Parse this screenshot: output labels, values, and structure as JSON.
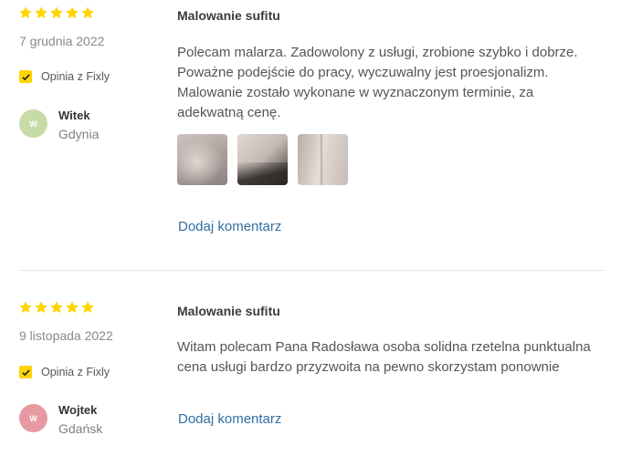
{
  "colors": {
    "star": "#ffd500",
    "badge_check": "#ffd500",
    "link": "#2f6fa3",
    "avatar_1": "#c7dba6",
    "avatar_2": "#e79aa2"
  },
  "reviews": [
    {
      "rating": 5,
      "date": "7 grudnia 2022",
      "badge": "Opinia z Fixly",
      "author": {
        "initial": "W",
        "name": "Witek",
        "city": "Gdynia"
      },
      "title": "Malowanie sufitu",
      "text": "Polecam malarza. Zadowolony z usługi, zrobione szybko i dobrze. Poważne podejście do pracy, wyczuwalny jest proesjonalizm. Malowanie zostało wykonane w wyznaczonym terminie, za adekwatną cenę.",
      "photos": 3,
      "comment_link": "Dodaj komentarz"
    },
    {
      "rating": 5,
      "date": "9 listopada 2022",
      "badge": "Opinia z Fixly",
      "author": {
        "initial": "W",
        "name": "Wojtek",
        "city": "Gdańsk"
      },
      "title": "Malowanie sufitu",
      "text": "Witam polecam Pana Radosława osoba solidna rzetelna punktualna cena usługi bardzo przyzwoita na pewno skorzystam ponownie",
      "comment_link": "Dodaj komentarz"
    }
  ]
}
